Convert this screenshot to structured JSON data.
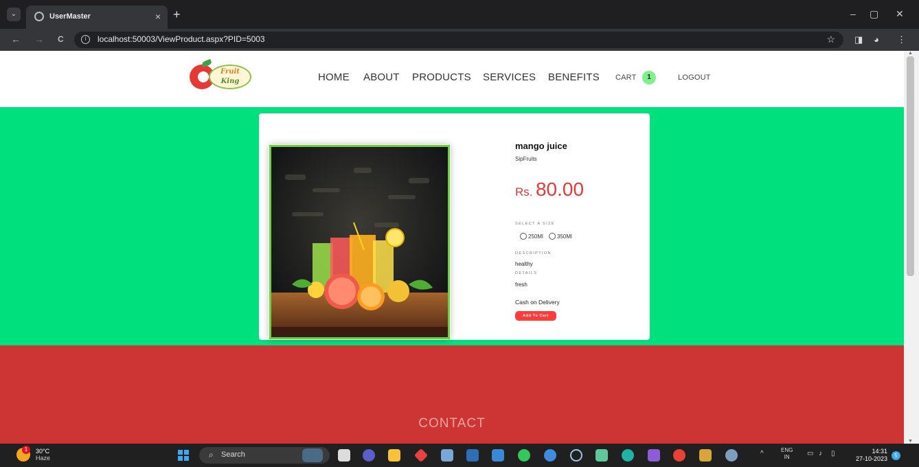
{
  "browser": {
    "tab_title": "UserMaster",
    "tab_close": "×",
    "new_tab": "+",
    "url": "localhost:50003/ViewProduct.aspx?PID=5003",
    "window_controls": {
      "minimize": "–",
      "restore": "▢",
      "close": "✕"
    },
    "nav": {
      "back": "←",
      "forward": "→",
      "reload": "C"
    }
  },
  "site": {
    "nav": {
      "home": "HOME",
      "about": "ABOUT",
      "products": "PRODUCTS",
      "services": "SERVICES",
      "benefits": "BENEFITS",
      "cart": "CART",
      "cart_count": "1",
      "logout": "LOGOUT"
    },
    "product": {
      "name": "mango juice",
      "brand": "SipFruits",
      "currency": "Rs.",
      "price": "80.00",
      "size_label": "SELECT A SIZE",
      "sizes": [
        "250Ml",
        "350Ml"
      ],
      "description_label": "DESCRIPTION",
      "description": "healthy",
      "details_label": "DETAILS",
      "details": "fresh",
      "payment": "Cash on Delivery",
      "add_to_cart": "Add To Cart"
    },
    "contact_heading": "CONTACT"
  },
  "taskbar": {
    "weather_temp": "30°C",
    "weather_cond": "Haze",
    "weather_badge": "1",
    "search_label": "Search",
    "lang_top": "ENG",
    "lang_bottom": "IN",
    "time": "14:31",
    "date": "27-10-2023",
    "notification_count": "5"
  },
  "colors": {
    "hero_bg": "#00e07d",
    "contact_bg": "#cd3535",
    "price": "#e53935",
    "add_button": "#ff3b3b",
    "cart_badge": "#7ef08c"
  }
}
